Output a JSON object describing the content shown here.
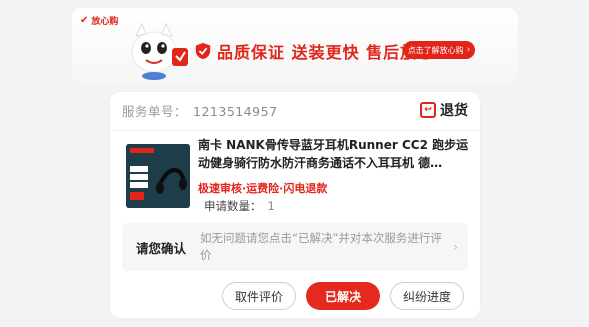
{
  "banner": {
    "tag_text": "放心购",
    "slogan": "品质保证 送装更快 售后放心",
    "button_label": "点击了解放心购",
    "colors": {
      "accent": "#e1251b"
    }
  },
  "service": {
    "label": "服务单号：",
    "number": "1213514957",
    "status": "退货"
  },
  "product": {
    "title": "南卡 NANK骨传导蓝牙耳机Runner CC2 跑步运动健身骑行防水防汗商务通话不入耳耳机 德…",
    "tags": "极速审核·运费险·闪电退款",
    "quantity_label": "申请数量：",
    "quantity_value": "1"
  },
  "confirm": {
    "label": "请您确认",
    "text": "如无问题请您点击“已解决”并对本次服务进行评价"
  },
  "actions": {
    "rate": "取件评价",
    "resolved": "已解决",
    "progress": "纠纷进度"
  }
}
